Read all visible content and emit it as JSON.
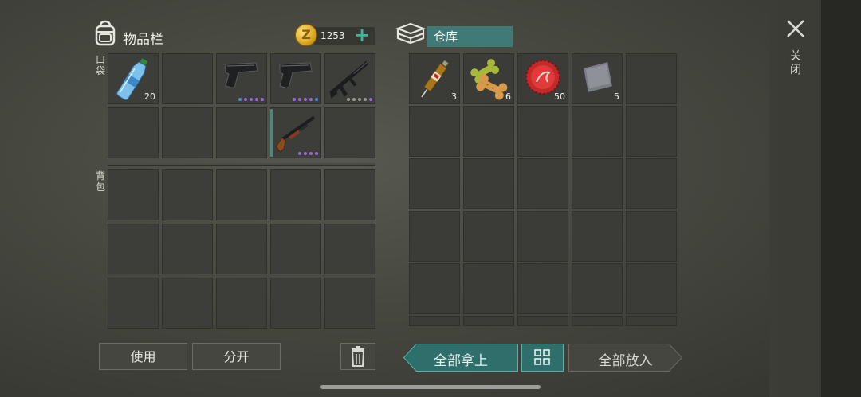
{
  "inventory": {
    "title": "物品栏",
    "coins": "1253",
    "coin_symbol": "Z",
    "pocket_label": "口袋",
    "backpack_label": "背包",
    "pocket_items": [
      {
        "icon": "water-bottle-icon",
        "qty": "20"
      },
      {
        "icon": "",
        "qty": ""
      },
      {
        "icon": "pistol-icon",
        "qty": ""
      },
      {
        "icon": "pistol-icon",
        "qty": ""
      },
      {
        "icon": "assault-rifle-icon",
        "qty": ""
      },
      {
        "icon": "",
        "qty": ""
      },
      {
        "icon": "",
        "qty": ""
      },
      {
        "icon": "",
        "qty": ""
      },
      {
        "icon": "shotgun-icon",
        "qty": ""
      },
      {
        "icon": "",
        "qty": ""
      }
    ]
  },
  "storage": {
    "title": "仓库",
    "items": [
      {
        "icon": "syringe-icon",
        "qty": "3"
      },
      {
        "icon": "dog-biscuit-icon",
        "qty": "6"
      },
      {
        "icon": "bottle-cap-icon",
        "qty": "50"
      },
      {
        "icon": "metal-plate-icon",
        "qty": "5"
      }
    ]
  },
  "buttons": {
    "use": "使用",
    "split": "分开",
    "take_all": "全部拿上",
    "put_all": "全部放入",
    "close": "关闭"
  },
  "colors": {
    "accent_teal": "#3f7a76",
    "mod_purple": "#9a6ad8",
    "mod_blue": "#4a8fd8",
    "mod_gray": "#9a9a94"
  }
}
